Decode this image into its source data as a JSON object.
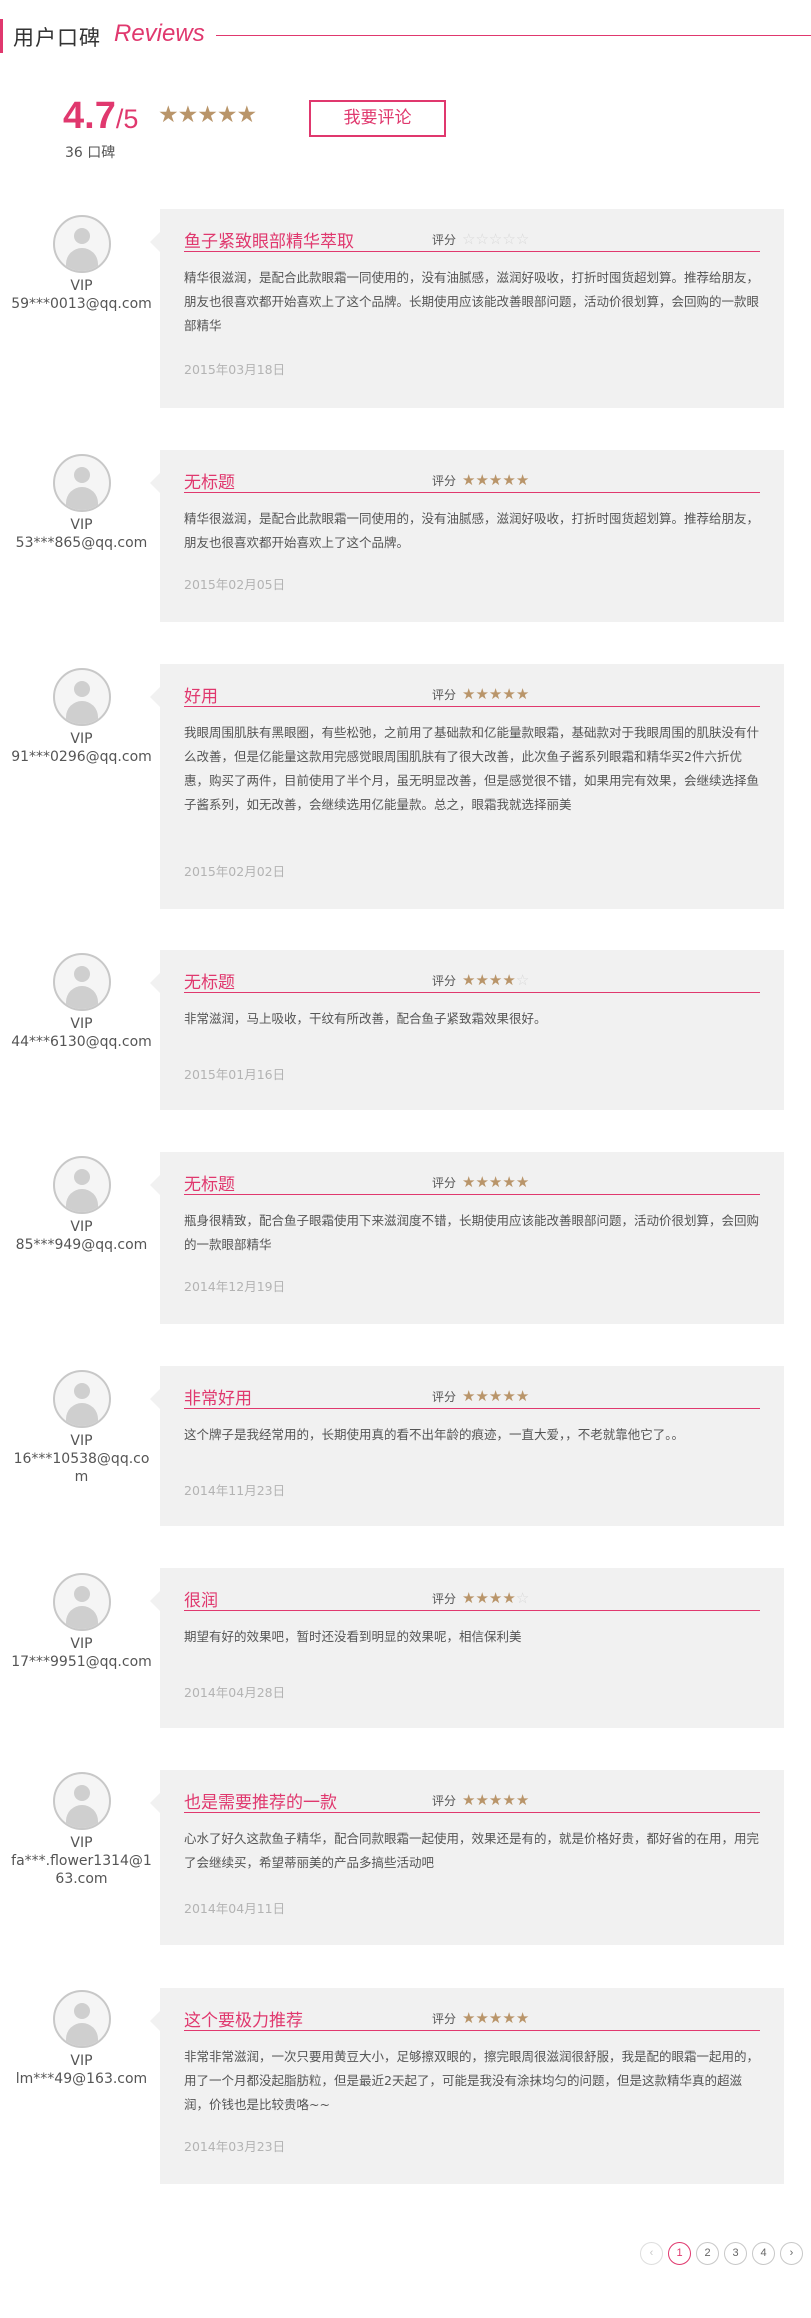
{
  "header": {
    "title_cn": "用户口碑",
    "title_en": "Reviews"
  },
  "summary": {
    "score": "4.7",
    "score_suffix": "/5",
    "rating_stars": 4.7,
    "count_text": "36 口碑",
    "write_review_label": "我要评论"
  },
  "rating_label": "评分",
  "vip_label": "VIP",
  "reviews": [
    {
      "user": "59***0013@qq.com",
      "title": "鱼子紧致眼部精华萃取",
      "stars": 0,
      "text": "精华很滋润，是配合此款眼霜一同使用的，没有油腻感，滋润好吸收，打折时囤货超划算。推荐给朋友，朋友也很喜欢都开始喜欢上了这个品牌。长期使用应该能改善眼部问题，活动价很划算，会回购的一款眼部精华",
      "date": "2015年03月18日"
    },
    {
      "user": "53***865@qq.com",
      "title": "无标题",
      "stars": 5,
      "text": "精华很滋润，是配合此款眼霜一同使用的，没有油腻感，滋润好吸收，打折时囤货超划算。推荐给朋友，朋友也很喜欢都开始喜欢上了这个品牌。",
      "date": "2015年02月05日"
    },
    {
      "user": "91***0296@qq.com",
      "title": "好用",
      "stars": 5,
      "text": "我眼周围肌肤有黑眼圈，有些松弛，之前用了基础款和亿能量款眼霜，基础款对于我眼周围的肌肤没有什么改善，但是亿能量这款用完感觉眼周围肌肤有了很大改善，此次鱼子酱系列眼霜和精华买2件六折优惠，购买了两件，目前使用了半个月，虽无明显改善，但是感觉很不错，如果用完有效果，会继续选择鱼子酱系列，如无改善，会继续选用亿能量款。总之，眼霜我就选择丽美",
      "date": "2015年02月02日"
    },
    {
      "user": "44***6130@qq.com",
      "title": "无标题",
      "stars": 4,
      "text": "非常滋润，马上吸收，干纹有所改善，配合鱼子紧致霜效果很好。",
      "date": "2015年01月16日"
    },
    {
      "user": "85***949@qq.com",
      "title": "无标题",
      "stars": 5,
      "text": "瓶身很精致，配合鱼子眼霜使用下来滋润度不错，长期使用应该能改善眼部问题，活动价很划算，会回购的一款眼部精华",
      "date": "2014年12月19日"
    },
    {
      "user": "16***10538@qq.com",
      "title": "非常好用",
      "stars": 5,
      "text": "这个牌子是我经常用的，长期使用真的看不出年龄的痕迹，一直大爱，，不老就靠他它了。。",
      "date": "2014年11月23日"
    },
    {
      "user": "17***9951@qq.com",
      "title": "很润",
      "stars": 4,
      "text": "期望有好的效果吧，暂时还没看到明显的效果呢，相信保利美",
      "date": "2014年04月28日"
    },
    {
      "user": "fa***.flower1314@163.com",
      "title": "也是需要推荐的一款",
      "stars": 5,
      "text": "心水了好久这款鱼子精华，配合同款眼霜一起使用，效果还是有的，就是价格好贵，都好省的在用，用完了会继续买，希望蒂丽美的产品多搞些活动吧",
      "date": "2014年04月11日"
    },
    {
      "user": "lm***49@163.com",
      "title": "这个要极力推荐",
      "stars": 5,
      "text": "非常非常滋润，一次只要用黄豆大小，足够擦双眼的，擦完眼周很滋润很舒服，我是配的眼霜一起用的，用了一个月都没起脂肪粒，但是最近2天起了，可能是我没有涂抹均匀的问题，但是这款精华真的超滋润，价钱也是比较贵咯~~",
      "date": "2014年03月23日"
    }
  ],
  "pagination": {
    "prev_icon": "‹",
    "pages": [
      "1",
      "2",
      "3",
      "4"
    ],
    "current": "1",
    "next_icon": "›"
  },
  "colors": {
    "accent": "#e0386e",
    "star_on": "#b9956a",
    "star_off": "#d8d8d8",
    "card_bg": "#f1f1f1"
  }
}
